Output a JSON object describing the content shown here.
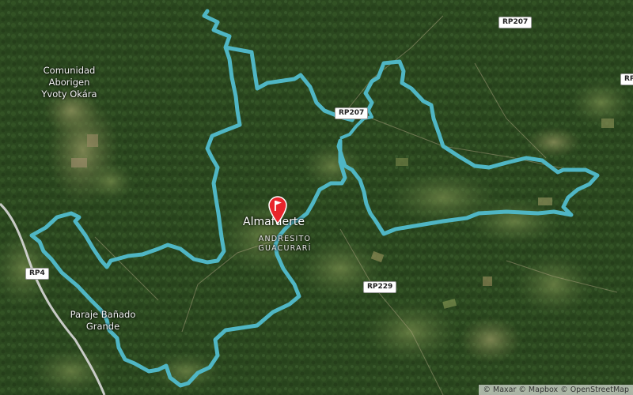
{
  "map": {
    "places": [
      {
        "id": "comunidad",
        "label": "Comunidad\nAborigen\nYvoty Okára"
      },
      {
        "id": "paraje",
        "label": "Paraje Bañado\nGrande"
      }
    ],
    "town": {
      "label": "Almafuerte"
    },
    "district": {
      "label": "ANDRESITO\nGUACURARÍ"
    },
    "roads": [
      {
        "id": "rp207-ne",
        "label": "RP207"
      },
      {
        "id": "rp207-mid",
        "label": "RP207"
      },
      {
        "id": "rp229",
        "label": "RP229"
      },
      {
        "id": "rp4",
        "label": "RP4"
      },
      {
        "id": "rp-edge",
        "label": "RP"
      }
    ],
    "route_color": "#4fb6c4",
    "marker_color": "#e8242b",
    "icons": [
      "flag-marker-icon"
    ]
  },
  "attribution": {
    "maxar": "© Maxar",
    "mapbox": "© Mapbox",
    "osm": "© OpenStreetMap"
  }
}
